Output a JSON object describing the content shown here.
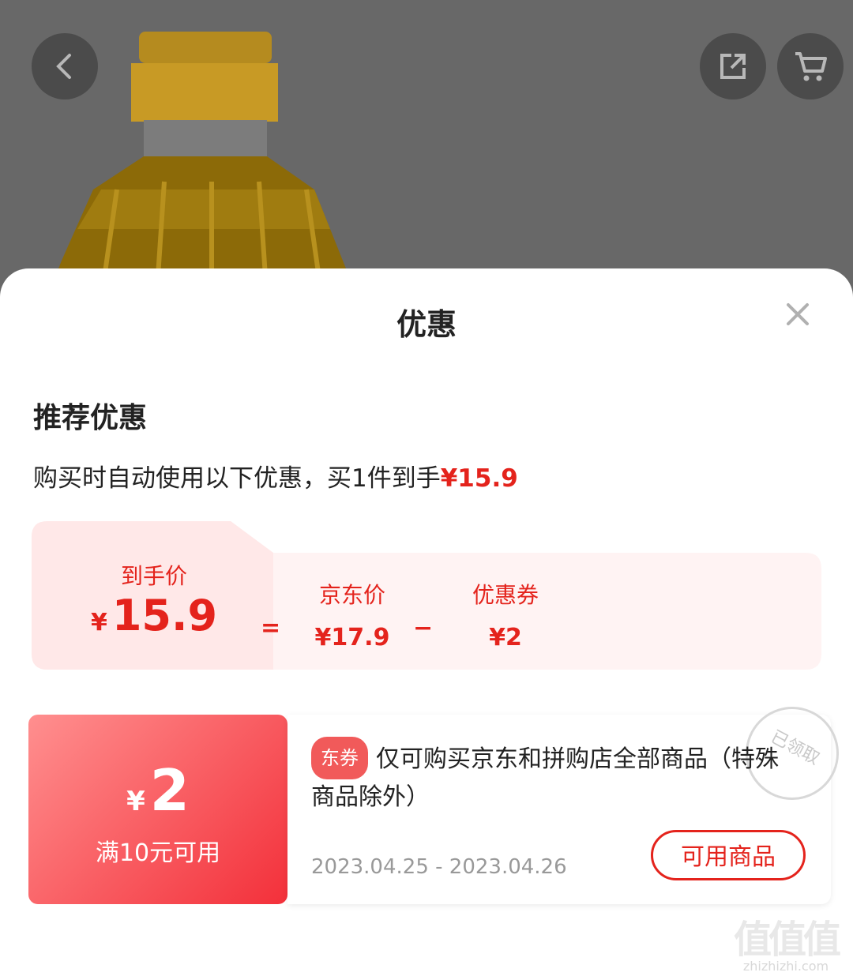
{
  "sheet": {
    "title": "优惠",
    "section_title": "推荐优惠",
    "summary_prefix": "购买时自动使用以下优惠，买1件到手",
    "summary_price": "¥15.9"
  },
  "calc": {
    "final_label": "到手价",
    "final_currency": "¥",
    "final_value": "15.9",
    "equals": "=",
    "jd_label": "京东价",
    "jd_value": "¥17.9",
    "minus": "−",
    "coupon_label": "优惠券",
    "coupon_value": "¥2"
  },
  "coupon": {
    "currency": "¥",
    "amount": "2",
    "condition": "满10元可用",
    "tag": "东券",
    "description": "仅可购买京东和拼购店全部商品（特殊商品除外）",
    "date_range": "2023.04.25 - 2023.04.26",
    "button": "可用商品",
    "stamp": "已领取"
  },
  "watermark": {
    "glyphs": "值值值",
    "url": "zhizhizhi.com"
  },
  "colors": {
    "accent": "#e4231c",
    "calc_bg": "#fff0f0"
  }
}
